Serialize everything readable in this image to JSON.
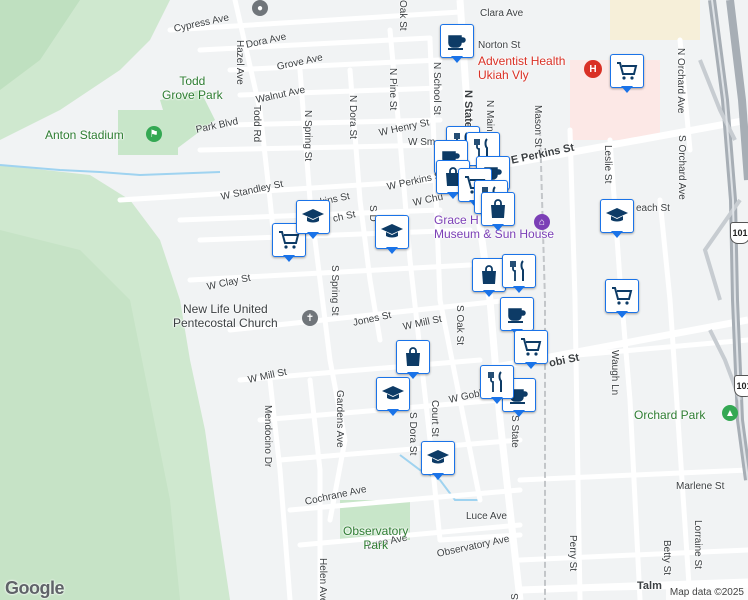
{
  "streets": {
    "cypress_ave": "Cypress Ave",
    "dora_ave": "Dora Ave",
    "grove_ave": "Grove Ave",
    "walnut_ave": "Walnut Ave",
    "park_blvd": "Park Blvd",
    "hazel_ave": "Hazel Ave",
    "todd_rd": "Todd Rd",
    "n_spring_st": "N Spring St",
    "n_dora_st": "N Dora St",
    "n_pine_st": "N Pine St",
    "oak_st_top": "Oak St",
    "n_school_st": "N School St",
    "n_state_st": "N State St",
    "n_main_st": "N Main St",
    "mason_st": "Mason St",
    "n_orchard_ave": "N Orchard Ave",
    "norton_st": "Norton St",
    "clara_ave": "Clara Ave",
    "w_henry_st": "W Henry St",
    "w_smith_st": "W Sm",
    "w_standley_st": "W Standley St",
    "w_perkins_st": "W Perkins St",
    "w_perkins_short": "rkins St",
    "e_perkins_st": "E Perkins St",
    "w_church_st": "W Chu",
    "church_st_w": "ch St",
    "leslie_st": "Leslie St",
    "s_orchard_ave": "S Orchard Ave",
    "beach_st": "each St",
    "w_clay_st": "W Clay St",
    "s_spring_st": "S Spring St",
    "s_dora_short": "S D",
    "jones_st": "Jones St",
    "w_mill_st": "W Mill St",
    "w_mill_st_2": "W Mill St",
    "s_oak_st": "S Oak St",
    "gobbi_st": "obi St",
    "w_gobbi": "W Gobb",
    "waugh_ln": "Waugh Ln",
    "mendocino_dr": "Mendocino Dr",
    "gardens_ave": "Gardens Ave",
    "court_st": "Court St",
    "s_dora_st": "S Dora St",
    "cochrane_ave": "Cochrane Ave",
    "luce_ave": "Luce Ave",
    "luce_ave_2": "Luce Ave",
    "observatory_ave": "Observatory Ave",
    "helen_ave": "Helen Ave",
    "perry_st": "Perry St",
    "betty_st": "Betty St",
    "lorraine_st": "Lorraine St",
    "marlene_st": "Marlene St",
    "talm": "Talm",
    "s_state": "S State",
    "state_st_bottom": "S"
  },
  "places": {
    "todd_grove_park": "Todd\nGrove Park",
    "anton_stadium": "Anton Stadium",
    "adventist_health": "Adventist Health\nUkiah Vly",
    "grace_museum": "Grace H\nMuseum & Sun House",
    "new_life_church": "New Life United\nPentecostal Church",
    "orchard_park": "Orchard Park",
    "observatory_park": "Observatory\nPark"
  },
  "highway": {
    "shield": "101"
  },
  "attribution": {
    "logo": "Google",
    "map_data": "Map data ©2025"
  },
  "colors": {
    "marker_border": "#1a73e8",
    "marker_icon": "#0d3b66",
    "park_green": "#c8e6c9",
    "hospital_pink": "#fce8e6"
  }
}
